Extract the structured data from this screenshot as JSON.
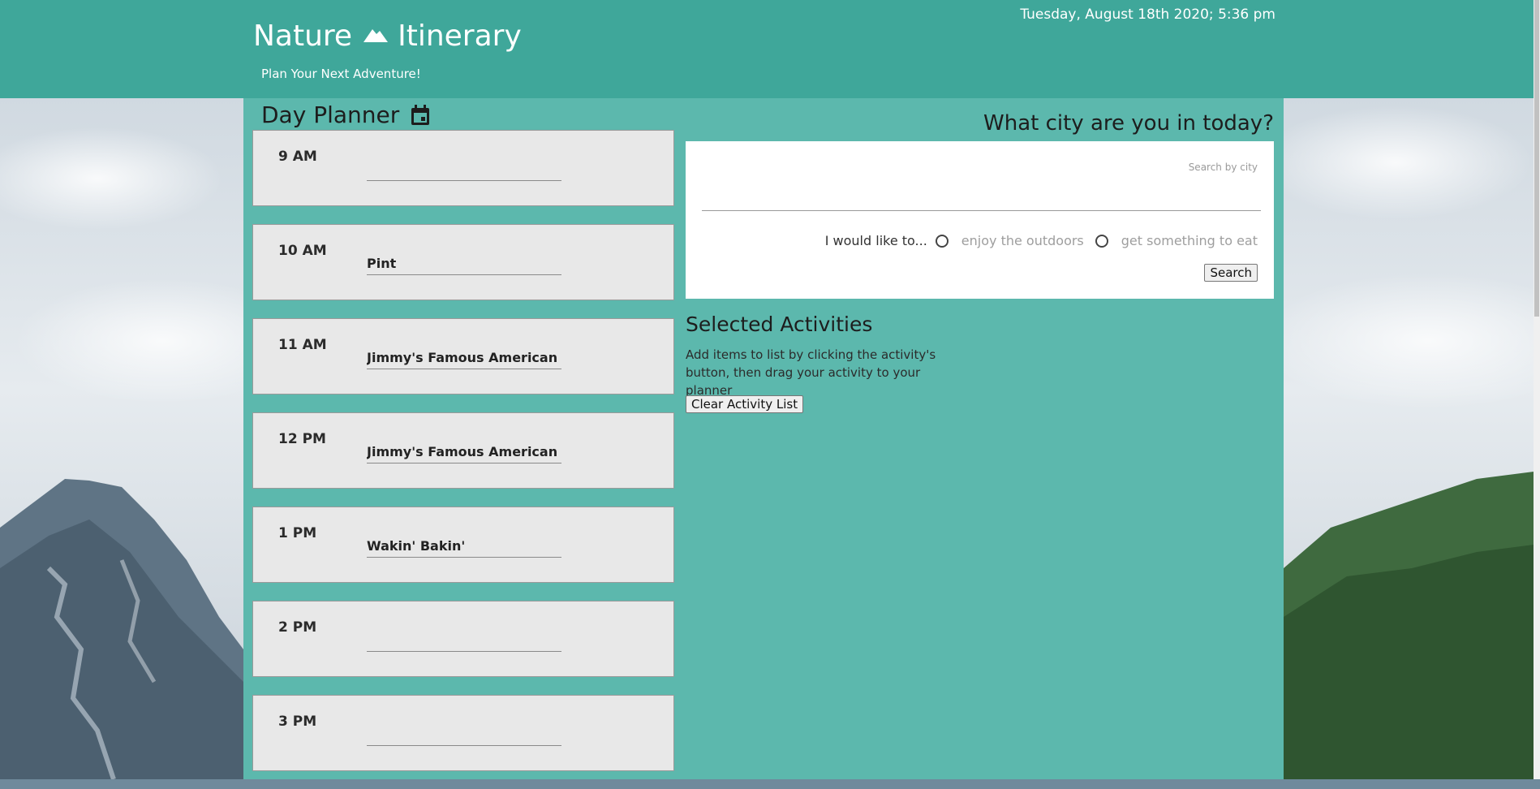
{
  "header": {
    "title_left": "Nature",
    "title_right": "Itinerary",
    "tagline": "Plan Your Next Adventure!",
    "datetime": "Tuesday, August 18th 2020; 5:36 pm",
    "mountain_icon": "mountain-icon"
  },
  "planner": {
    "title": "Day Planner",
    "calendar_icon": "calendar-icon",
    "slots": [
      {
        "hour": "9 AM",
        "activity": ""
      },
      {
        "hour": "10 AM",
        "activity": "Pint"
      },
      {
        "hour": "11 AM",
        "activity": "Jimmy's Famous American Tavern"
      },
      {
        "hour": "12 PM",
        "activity": "Jimmy's Famous American Tavern"
      },
      {
        "hour": "1 PM",
        "activity": "Wakin' Bakin'"
      },
      {
        "hour": "2 PM",
        "activity": ""
      },
      {
        "hour": "3 PM",
        "activity": ""
      }
    ]
  },
  "search": {
    "question": "What city are you in today?",
    "label": "Search by city",
    "value": "",
    "lead": "I would like to...",
    "option_outdoors": "enjoy the outdoors",
    "option_eat": "get something to eat",
    "button": "Search"
  },
  "selected": {
    "title": "Selected Activities",
    "hint": "Add items to list by clicking the activity's button, then drag your activity to your planner",
    "clear_button": "Clear Activity List"
  },
  "colors": {
    "header": "#3fa79a",
    "panel": "#5cb8ad",
    "slot": "#e8e8e8"
  }
}
